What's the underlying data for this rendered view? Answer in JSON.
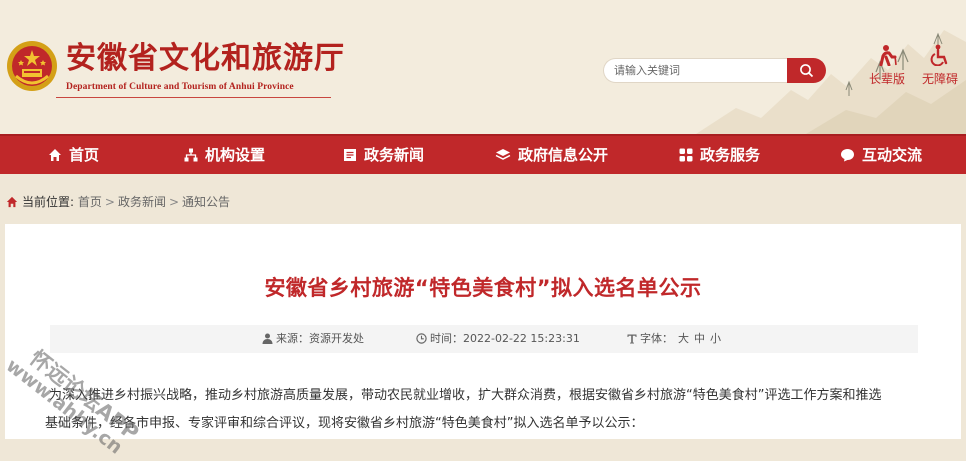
{
  "header": {
    "title": "安徽省文化和旅游厅",
    "subtitle": "Department of Culture and Tourism of Anhui Province",
    "emblem_icon": "national-emblem-icon",
    "search": {
      "placeholder": "请输入关键词",
      "value": ""
    },
    "utilities": [
      {
        "label": "长辈版",
        "icon": "elder-person-icon"
      },
      {
        "label": "无障碍",
        "icon": "wheelchair-icon"
      }
    ],
    "accent_color": "#c0282a"
  },
  "nav": {
    "items": [
      {
        "label": "首页",
        "icon": "home-icon"
      },
      {
        "label": "机构设置",
        "icon": "org-chart-icon"
      },
      {
        "label": "政务新闻",
        "icon": "news-icon"
      },
      {
        "label": "政府信息公开",
        "icon": "info-open-icon"
      },
      {
        "label": "政务服务",
        "icon": "grid-services-icon"
      },
      {
        "label": "互动交流",
        "icon": "chat-icon"
      }
    ]
  },
  "breadcrumb": {
    "label": "当前位置:",
    "items": [
      "首页",
      "政务新闻",
      "通知公告"
    ],
    "separator": ">"
  },
  "article": {
    "title": "安徽省乡村旅游“特色美食村”拟入选名单公示",
    "source": "来源：资源开发处",
    "time": "时间：2022-02-22 15:23:31",
    "font_label": "字体：",
    "font_sizes": [
      "大",
      "中",
      "小"
    ],
    "paragraph1": "为深入推进乡村振兴战略，推动乡村旅游高质量发展，带动农民就业增收，扩大群众消费，根据安徽省乡村旅游“特色美食村”评选工作方案和推选",
    "paragraph2": "基础条件，经各市申报、专家评审和综合评议，现将安徽省乡村旅游“特色美食村”拟入选名单予以公示："
  },
  "watermark": {
    "line1": "怀远论坛APP",
    "line2": "www.ahhy.cn"
  }
}
